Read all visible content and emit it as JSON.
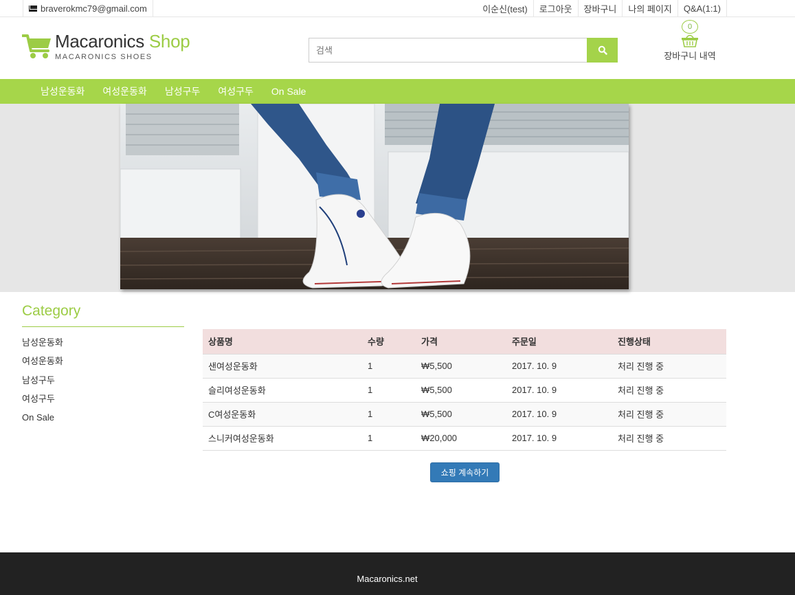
{
  "topbar": {
    "email": "braverokmc79@gmail.com",
    "links": [
      "이순신(test)",
      "로그아웃",
      "장바구니",
      "나의 페이지",
      "Q&A(1:1)"
    ]
  },
  "header": {
    "logo_main": "Macaronics",
    "logo_accent": "Shop",
    "logo_sub": "MACARONICS SHOES",
    "search_placeholder": "검색",
    "cart_count": "0",
    "cart_label": "장바구니 내역"
  },
  "nav": {
    "items": [
      "남성운동화",
      "여성운동화",
      "남성구두",
      "여성구두",
      "On Sale"
    ]
  },
  "sidebar": {
    "title": "Category",
    "items": [
      "남성운동화",
      "여성운동화",
      "남성구두",
      "여성구두",
      "On Sale"
    ]
  },
  "orders": {
    "headers": [
      "상품명",
      "수량",
      "가격",
      "주문일",
      "진행상태"
    ],
    "rows": [
      [
        "샌여성운동화",
        "1",
        "₩5,500",
        "2017. 10. 9",
        "처리 진행 중"
      ],
      [
        "슬리여성운동화",
        "1",
        "₩5,500",
        "2017. 10. 9",
        "처리 진행 중"
      ],
      [
        "C여성운동화",
        "1",
        "₩5,500",
        "2017. 10. 9",
        "처리 진행 중"
      ],
      [
        "스니커여성운동화",
        "1",
        "₩20,000",
        "2017. 10. 9",
        "처리 진행 중"
      ]
    ]
  },
  "continue_button": "쇼핑 계속하기",
  "footer": {
    "text": "Macaronics.net"
  },
  "colors": {
    "accent": "#a6d64a",
    "table_header": "#f2dede",
    "button": "#337ab7",
    "footer": "#222222"
  }
}
